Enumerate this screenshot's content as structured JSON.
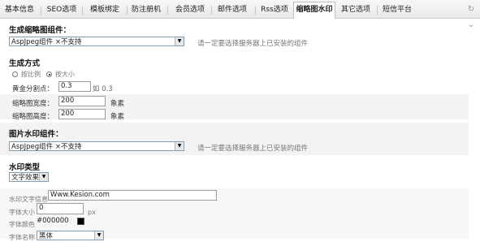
{
  "tabs": [
    {
      "label": "基本信息",
      "active": false
    },
    {
      "label": "SEO选项",
      "active": false
    },
    {
      "label": "模板绑定",
      "active": false
    },
    {
      "label": "防注册机",
      "active": false
    },
    {
      "label": "会员选项",
      "active": false
    },
    {
      "label": "邮件选项",
      "active": false
    },
    {
      "label": "Rss选项",
      "active": false
    },
    {
      "label": "缩略图水印",
      "active": true
    },
    {
      "label": "其它选项",
      "active": false
    },
    {
      "label": "短信平台",
      "active": false
    }
  ],
  "thumb_component": {
    "heading": "生成缩略图组件：",
    "selected": "AspJpeg组件 ×不支持",
    "hint": "请一定要选择服务器上已安装的组件"
  },
  "generate_mode": {
    "heading": "生成方式",
    "option_ratio": "按比例",
    "option_size": "按大小",
    "selected": "按大小",
    "golden_label": "黄金分割点：",
    "golden_value": "0.3",
    "golden_suffix": "如 0.3",
    "width_label": "缩略图宽度：",
    "width_value": "200",
    "width_unit": "象素",
    "height_label": "缩略图高度：",
    "height_value": "200",
    "height_unit": "象素"
  },
  "watermark_component": {
    "heading": "图片水印组件：",
    "selected": "AspJpeg组件 ×不支持",
    "hint": "请一定要选择服务器上已安装的组件"
  },
  "watermark_type": {
    "heading": "水印类型",
    "selected": "文字效果"
  },
  "watermark_text": {
    "text_label": "水印文字信息",
    "text_value": "Www.Kesion.com",
    "size_label": "字体大小",
    "size_value": "0",
    "size_unit": "px",
    "color_label": "字体颜色",
    "color_value": "#000000",
    "font_label": "字体名称",
    "font_value": "黑体"
  },
  "colors": {
    "accent": "#7f9db9",
    "swatch": "#000000"
  }
}
